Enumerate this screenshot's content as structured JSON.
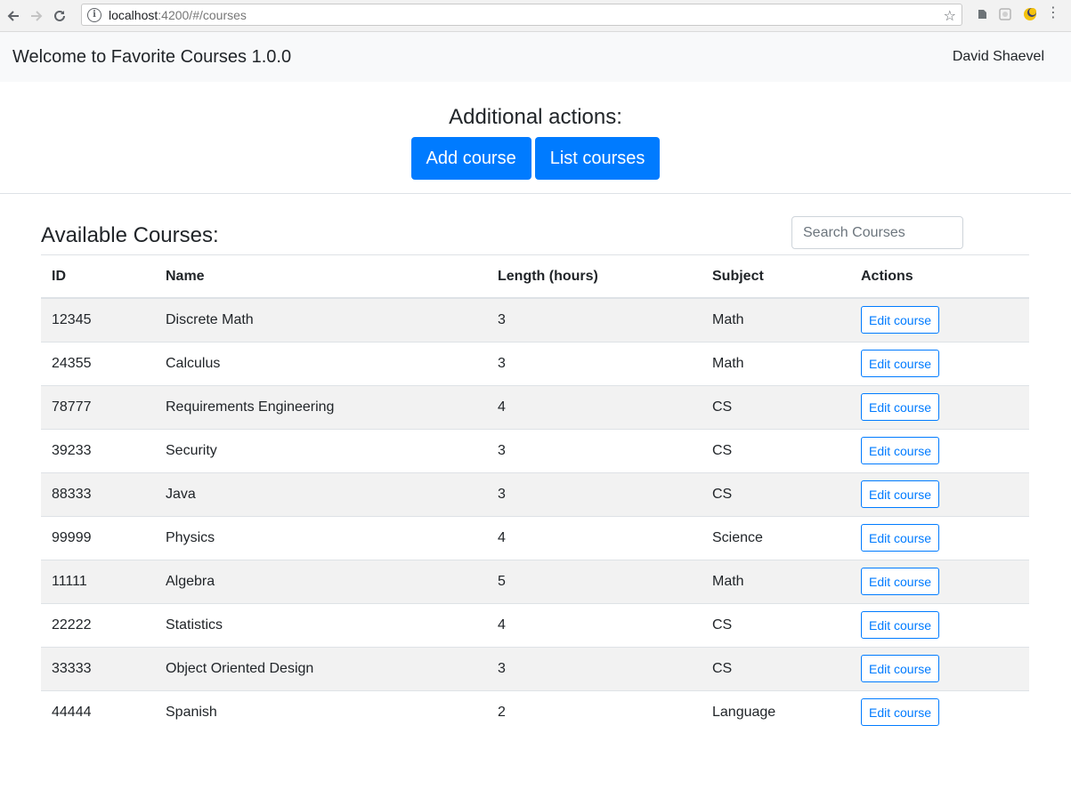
{
  "browser": {
    "url_host": "localhost",
    "url_rest": ":4200/#/courses"
  },
  "navbar": {
    "brand": "Welcome to Favorite Courses 1.0.0",
    "user": "David Shaevel"
  },
  "actions": {
    "title": "Additional actions:",
    "add_label": "Add course",
    "list_label": "List courses"
  },
  "courses": {
    "title": "Available Courses:",
    "search_placeholder": "Search Courses",
    "columns": [
      "ID",
      "Name",
      "Length (hours)",
      "Subject",
      "Actions"
    ],
    "edit_label": "Edit course",
    "rows": [
      {
        "id": "12345",
        "name": "Discrete Math",
        "length": "3",
        "subject": "Math"
      },
      {
        "id": "24355",
        "name": "Calculus",
        "length": "3",
        "subject": "Math"
      },
      {
        "id": "78777",
        "name": "Requirements Engineering",
        "length": "4",
        "subject": "CS"
      },
      {
        "id": "39233",
        "name": "Security",
        "length": "3",
        "subject": "CS"
      },
      {
        "id": "88333",
        "name": "Java",
        "length": "3",
        "subject": "CS"
      },
      {
        "id": "99999",
        "name": "Physics",
        "length": "4",
        "subject": "Science"
      },
      {
        "id": "11111",
        "name": "Algebra",
        "length": "5",
        "subject": "Math"
      },
      {
        "id": "22222",
        "name": "Statistics",
        "length": "4",
        "subject": "CS"
      },
      {
        "id": "33333",
        "name": "Object Oriented Design",
        "length": "3",
        "subject": "CS"
      },
      {
        "id": "44444",
        "name": "Spanish",
        "length": "2",
        "subject": "Language"
      }
    ]
  },
  "colors": {
    "primary": "#007bff",
    "navbar_bg": "#f8f9fa",
    "stripe": "#f2f2f2"
  }
}
